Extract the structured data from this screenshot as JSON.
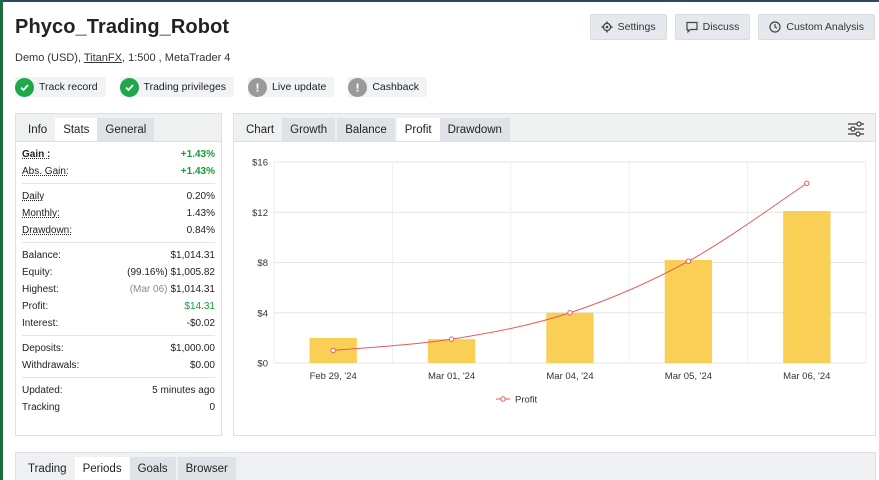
{
  "title": "Phyco_Trading_Robot",
  "subtitle": {
    "prefix": "Demo (USD), ",
    "broker": "TitanFX",
    "suffix": ", 1:500 , MetaTrader 4"
  },
  "top_buttons": {
    "settings": "Settings",
    "discuss": "Discuss",
    "custom_analysis": "Custom Analysis"
  },
  "badges": {
    "track_record": "Track record",
    "trading_privileges": "Trading privileges",
    "live_update": "Live update",
    "cashback": "Cashback"
  },
  "stats_tabs": {
    "info": "Info",
    "stats": "Stats",
    "general": "General"
  },
  "stats": {
    "gain_label": "Gain :",
    "gain": "+1.43%",
    "abs_gain_label": "Abs. Gain:",
    "abs_gain": "+1.43%",
    "daily_label": "Daily",
    "daily": "0.20%",
    "monthly_label": "Monthly:",
    "monthly": "1.43%",
    "drawdown_label": "Drawdown:",
    "drawdown": "0.84%",
    "balance_label": "Balance:",
    "balance": "$1,014.31",
    "equity_label": "Equity:",
    "equity_pct": "(99.16%)",
    "equity": "$1,005.82",
    "highest_label": "Highest:",
    "highest_date": "(Mar 06)",
    "highest": "$1,014.31",
    "profit_label": "Profit:",
    "profit": "$14.31",
    "interest_label": "Interest:",
    "interest": "-$0.02",
    "deposits_label": "Deposits:",
    "deposits": "$1,000.00",
    "withdrawals_label": "Withdrawals:",
    "withdrawals": "$0.00",
    "updated_label": "Updated:",
    "updated": "5 minutes ago",
    "tracking_label": "Tracking",
    "tracking": "0"
  },
  "chart_tabs": {
    "chart": "Chart",
    "growth": "Growth",
    "balance": "Balance",
    "profit": "Profit",
    "drawdown": "Drawdown"
  },
  "bottom_tabs": {
    "trading": "Trading",
    "periods": "Periods",
    "goals": "Goals",
    "browser": "Browser"
  },
  "colors": {
    "bar": "#f9d055",
    "line": "#e45a5a",
    "green": "#1a9a3a"
  },
  "chart_data": {
    "type": "bar",
    "categories": [
      "Feb 29, '24",
      "Mar 01, '24",
      "Mar 04, '24",
      "Mar 05, '24",
      "Mar 06, '24"
    ],
    "series": [
      {
        "type": "bar",
        "values": [
          2.0,
          1.9,
          4.0,
          8.2,
          12.1
        ]
      },
      {
        "name": "Profit",
        "type": "line",
        "values": [
          1.0,
          1.9,
          4.0,
          8.1,
          14.3
        ]
      }
    ],
    "ylim": [
      0,
      16
    ],
    "yticks": [
      "$0",
      "$4",
      "$8",
      "$12",
      "$16"
    ],
    "ytick_values": [
      0,
      4,
      8,
      12,
      16
    ],
    "grid": true,
    "legend": "bottom-center"
  }
}
